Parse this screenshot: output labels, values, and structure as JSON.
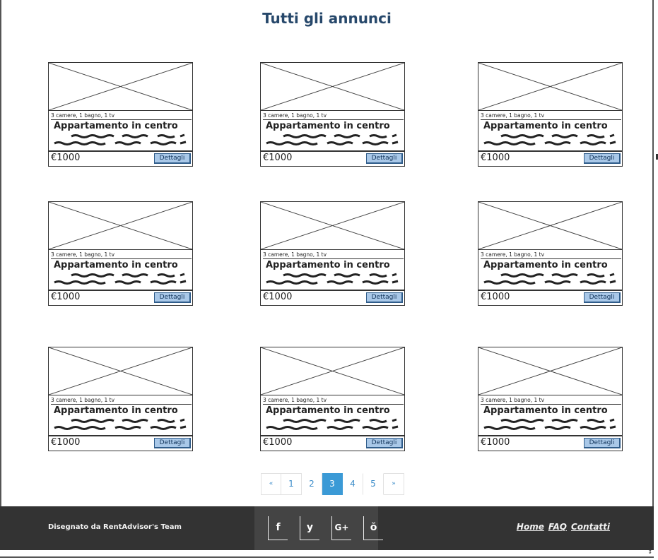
{
  "page": {
    "title": "Tutti gli annunci"
  },
  "listings": [
    {
      "specs": "3 camere, 1 bagno, 1 tv",
      "title": "Appartamento in centro",
      "price": "€1000",
      "button": "Dettagli"
    },
    {
      "specs": "3 camere, 1 bagno, 1 tv",
      "title": "Appartamento in centro",
      "price": "€1000",
      "button": "Dettagli"
    },
    {
      "specs": "3 camere, 1 bagno, 1 tv",
      "title": "Appartamento in centro",
      "price": "€1000",
      "button": "Dettagli"
    },
    {
      "specs": "3 camere, 1 bagno, 1 tv",
      "title": "Appartamento in centro",
      "price": "€1000",
      "button": "Dettagli"
    },
    {
      "specs": "3 camere, 1 bagno, 1 tv",
      "title": "Appartamento in centro",
      "price": "€1000",
      "button": "Dettagli"
    },
    {
      "specs": "3 camere, 1 bagno, 1 tv",
      "title": "Appartamento in centro",
      "price": "€1000",
      "button": "Dettagli"
    },
    {
      "specs": "3 camere, 1 bagno, 1 tv",
      "title": "Appartamento in centro",
      "price": "€1000",
      "button": "Dettagli"
    },
    {
      "specs": "3 camere, 1 bagno, 1 tv",
      "title": "Appartamento in centro",
      "price": "€1000",
      "button": "Dettagli"
    },
    {
      "specs": "3 camere, 1 bagno, 1 tv",
      "title": "Appartamento in centro",
      "price": "€1000",
      "button": "Dettagli"
    }
  ],
  "pagination": {
    "prev": "«",
    "pages": [
      "1",
      "2",
      "3",
      "4",
      "5"
    ],
    "active": "3",
    "next": "»"
  },
  "footer": {
    "credit": "Disegnato da RentAdvisor's Team",
    "social": [
      {
        "icon": "facebook-icon",
        "glyph": "f"
      },
      {
        "icon": "twitter-icon",
        "glyph": "y"
      },
      {
        "icon": "google-plus-icon",
        "glyph": "G+"
      },
      {
        "icon": "youtube-icon",
        "glyph": "ŏ"
      }
    ],
    "links": [
      "Home",
      "FAQ",
      "Contatti"
    ]
  },
  "colors": {
    "title": "#27486b",
    "button_bg": "#a9c8e8",
    "pagination_active": "#3b9ad6",
    "footer_bg": "#333333"
  }
}
